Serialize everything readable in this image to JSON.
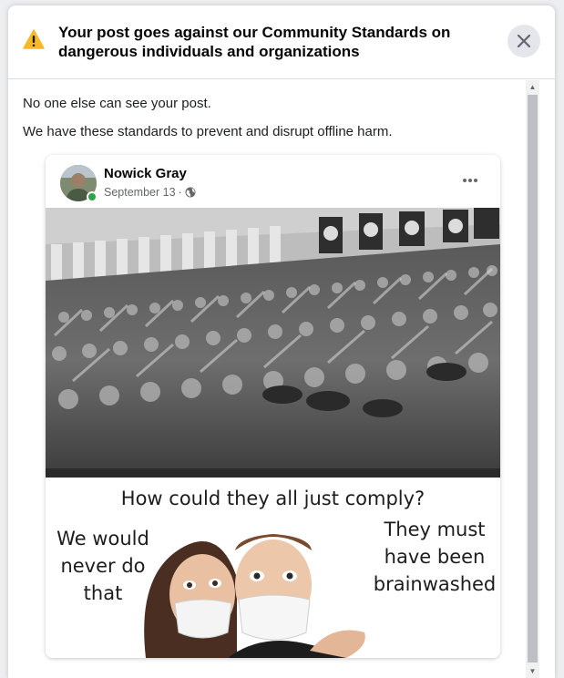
{
  "dialog": {
    "title": "Your post goes against our Community Standards on dangerous individuals and organizations",
    "warning_icon": "warning-triangle-icon",
    "close_icon": "close-icon",
    "message_1": "No one else can see your post.",
    "message_2": "We have these standards to prevent and disrupt offline harm."
  },
  "post": {
    "author": "Nowick Gray",
    "date": "September 13",
    "separator": "·",
    "privacy_icon": "globe-icon",
    "more_icon": "more-horizontal-icon",
    "image": {
      "caption_top": "How could they all just comply?",
      "caption_left": "We would never do that",
      "caption_right": "They must have been brainwashed"
    }
  },
  "colors": {
    "warning": "#f7b928",
    "online": "#31a24c",
    "text_primary": "#050505",
    "text_secondary": "#65676b"
  }
}
